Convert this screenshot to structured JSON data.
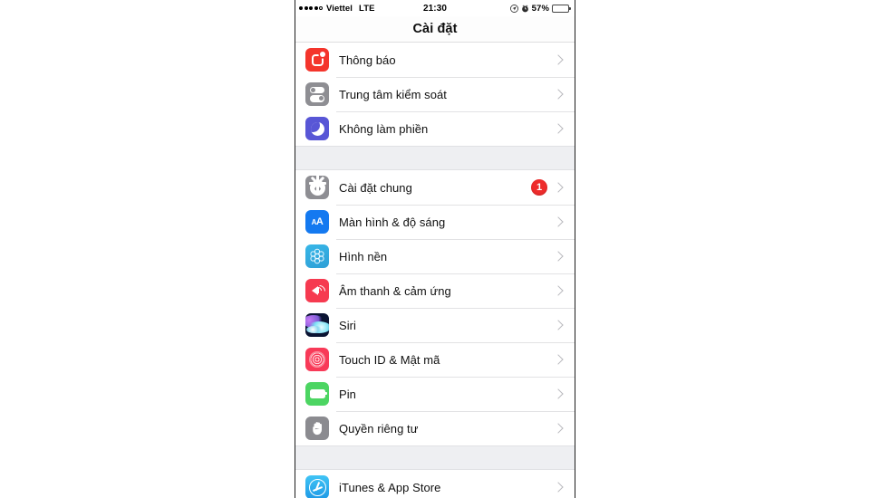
{
  "statusbar": {
    "signal_dots_filled": 4,
    "signal_dots_total": 5,
    "carrier": "Viettel",
    "network": "LTE",
    "time": "21:30",
    "battery_percent": "57%",
    "battery_level": 57,
    "icons": [
      "location-arrow-icon",
      "alarm-clock-icon",
      "battery-icon"
    ]
  },
  "navbar": {
    "title": "Cài đặt"
  },
  "colors": {
    "notifications": "#f4352c",
    "control_center": "#8e8e93",
    "do_not_disturb": "#5856d6",
    "general": "#8e8e93",
    "display": "#1479f0",
    "wallpaper": "#2f9fd6",
    "sounds": "#f63a50",
    "siri": "#0b1433",
    "touch_id": "#f83a58",
    "battery": "#4cd562",
    "privacy": "#8b8b90",
    "app_store": "#1f9ae6",
    "badge": "#ee2c2c",
    "chevron": "#b9b9be",
    "group_gap": "#eeeff2"
  },
  "groups": [
    {
      "id": "group-1",
      "rows": [
        {
          "label": "Thông báo",
          "icon": "notifications-icon",
          "badge": null,
          "chevron": true
        },
        {
          "label": "Trung tâm kiểm soát",
          "icon": "control-center-icon",
          "badge": null,
          "chevron": true
        },
        {
          "label": "Không làm phiền",
          "icon": "do-not-disturb-icon",
          "badge": null,
          "chevron": true
        }
      ]
    },
    {
      "id": "group-2",
      "rows": [
        {
          "label": "Cài đặt chung",
          "icon": "gear-icon",
          "badge": "1",
          "chevron": true
        },
        {
          "label": "Màn hình & độ sáng",
          "icon": "display-aa-icon",
          "badge": null,
          "chevron": true
        },
        {
          "label": "Hình nền",
          "icon": "wallpaper-icon",
          "badge": null,
          "chevron": true
        },
        {
          "label": "Âm thanh & cảm ứng",
          "icon": "speaker-icon",
          "badge": null,
          "chevron": true
        },
        {
          "label": "Siri",
          "icon": "siri-icon",
          "badge": null,
          "chevron": true
        },
        {
          "label": "Touch ID & Mật mã",
          "icon": "fingerprint-icon",
          "badge": null,
          "chevron": true
        },
        {
          "label": "Pin",
          "icon": "battery-icon",
          "badge": null,
          "chevron": true
        },
        {
          "label": "Quyền riêng tư",
          "icon": "hand-icon",
          "badge": null,
          "chevron": true
        }
      ]
    },
    {
      "id": "group-3",
      "rows": [
        {
          "label": "iTunes & App Store",
          "icon": "app-store-icon",
          "badge": null,
          "chevron": true
        }
      ]
    }
  ]
}
